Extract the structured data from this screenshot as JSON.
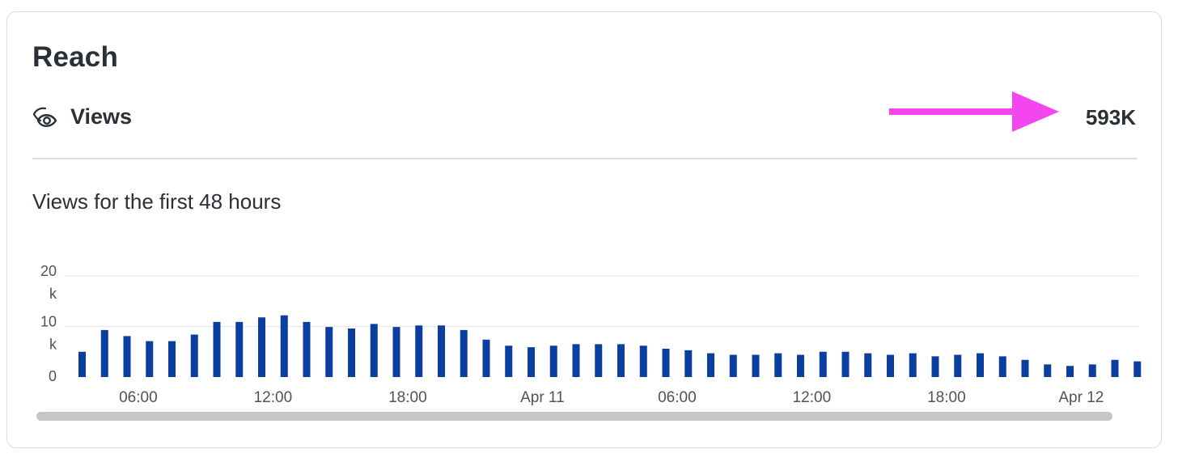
{
  "card": {
    "title": "Reach",
    "views_icon": "eye-icon",
    "views_label": "Views",
    "views_value": "593K",
    "annotation": {
      "icon": "arrow-right-icon",
      "color": "#f446ee"
    },
    "subtitle": "Views for the first 48 hours"
  },
  "colors": {
    "bar": "#0a3fa0",
    "grid": "#e9e9e9",
    "tick_text": "#4f5359",
    "scrollbar": "#c6c6c6"
  },
  "chart_data": {
    "type": "bar",
    "title": "Views for the first 48 hours",
    "xlabel": "",
    "ylabel": "",
    "ylim": [
      0,
      20000
    ],
    "y_ticks": [
      {
        "value": 0,
        "label": [
          "0"
        ]
      },
      {
        "value": 10000,
        "label": [
          "10",
          "k"
        ]
      },
      {
        "value": 20000,
        "label": [
          "20",
          "k"
        ]
      }
    ],
    "x_ticks": [
      {
        "index": 2,
        "label": "06:00"
      },
      {
        "index": 8,
        "label": "12:00"
      },
      {
        "index": 14,
        "label": "18:00"
      },
      {
        "index": 20,
        "label": "Apr 11"
      },
      {
        "index": 26,
        "label": "06:00"
      },
      {
        "index": 32,
        "label": "12:00"
      },
      {
        "index": 38,
        "label": "18:00"
      },
      {
        "index": 44,
        "label": "Apr 12"
      }
    ],
    "grid": true,
    "legend": "none",
    "series": [
      {
        "values": [
          5000,
          9300,
          8100,
          7100,
          7100,
          8400,
          10900,
          10900,
          11800,
          12200,
          10900,
          9900,
          9600,
          10500,
          9900,
          10200,
          10200,
          9300,
          7400,
          6200,
          5900,
          6200,
          6500,
          6500,
          6500,
          6200,
          5600,
          5300,
          4700,
          4400,
          4400,
          4700,
          4400,
          5000,
          5000,
          4700,
          4400,
          4700,
          4100,
          4400,
          4700,
          4100,
          3400,
          2500,
          2200,
          2500,
          3400,
          3100
        ]
      }
    ]
  }
}
